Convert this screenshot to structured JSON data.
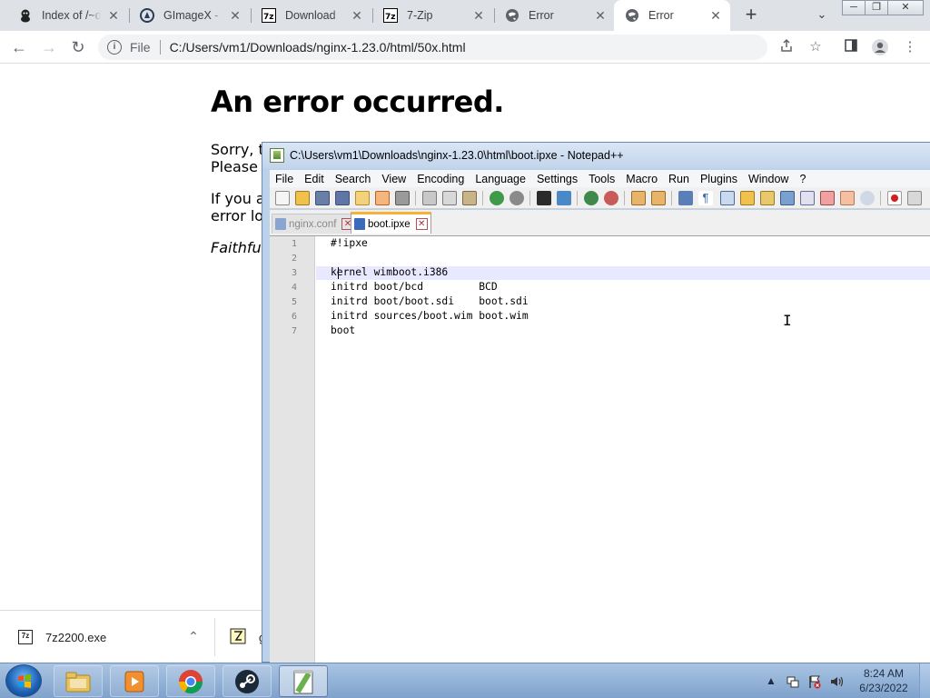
{
  "browser": {
    "tabs": [
      {
        "title": "Index of /~d",
        "icon": "mascot-icon",
        "active": false
      },
      {
        "title": "GImageX - G",
        "icon": "gimagex-icon",
        "active": false
      },
      {
        "title": "Download",
        "icon": "7zip-icon",
        "active": false
      },
      {
        "title": "7-Zip",
        "icon": "7zip-icon",
        "active": false
      },
      {
        "title": "Error",
        "icon": "globe-icon",
        "active": false
      },
      {
        "title": "Error",
        "icon": "globe-icon",
        "active": true
      }
    ],
    "new_tab": "+",
    "address": {
      "scheme_label": "File",
      "url": "C:/Users/vm1/Downloads/nginx-1.23.0/html/50x.html"
    }
  },
  "page": {
    "heading": "An error occurred.",
    "lines": [
      "Sorry, th",
      "Please t",
      "If you a",
      "error log",
      "Faithfull"
    ]
  },
  "downloads": {
    "items": [
      {
        "name": "7z2200.exe",
        "icon": "7z"
      },
      {
        "name": "g",
        "icon": "zip"
      }
    ]
  },
  "notepad": {
    "title": "C:\\Users\\vm1\\Downloads\\nginx-1.23.0\\html\\boot.ipxe - Notepad++",
    "menu": [
      "File",
      "Edit",
      "Search",
      "View",
      "Encoding",
      "Language",
      "Settings",
      "Tools",
      "Macro",
      "Run",
      "Plugins",
      "Window",
      "?"
    ],
    "tabs": [
      {
        "name": "nginx.conf",
        "active": false
      },
      {
        "name": "boot.ipxe",
        "active": true
      }
    ],
    "lines": [
      {
        "n": "1",
        "text": "#!ipxe"
      },
      {
        "n": "2",
        "text": ""
      },
      {
        "n": "3",
        "text": "kernel wimboot.i386"
      },
      {
        "n": "4",
        "text": "initrd boot/bcd         BCD"
      },
      {
        "n": "5",
        "text": "initrd boot/boot.sdi    boot.sdi"
      },
      {
        "n": "6",
        "text": "initrd sources/boot.wim boot.wim"
      },
      {
        "n": "7",
        "text": "boot"
      }
    ]
  },
  "taskbar": {
    "apps": [
      "file-explorer",
      "media-player",
      "chrome",
      "steam",
      "notepad-plus-plus"
    ],
    "time": "8:24 AM",
    "date": "6/23/2022"
  },
  "colors": {
    "tabstrip": "#dee1e6",
    "notepad_frame": "#bcd1ea",
    "current_line": "#e8e8ff",
    "taskbar": "#8fb0d8"
  }
}
